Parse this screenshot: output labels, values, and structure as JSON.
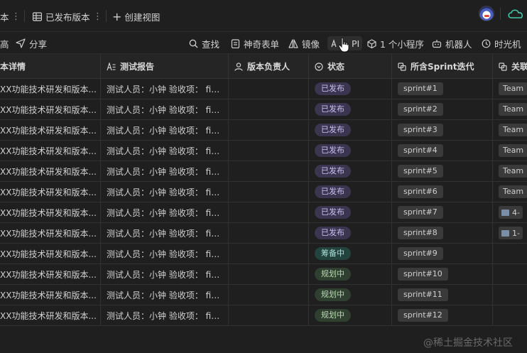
{
  "viewbar": {
    "partial_tab_label": "本",
    "view_tab_label": "已发布版本",
    "create_view_label": "创建视图"
  },
  "toolbar": {
    "partial_label": "高",
    "share_label": "分享",
    "search_label": "查找",
    "magic_form_label": "神奇表单",
    "mirror_label": "镜像",
    "api_label": "PI",
    "mini_program_label": "1 个小程序",
    "robot_label": "机器人",
    "time_machine_label": "时光机"
  },
  "columns": [
    {
      "label": "本详情",
      "icon": "text-icon"
    },
    {
      "label": "测试报告",
      "icon": "long-text-icon"
    },
    {
      "label": "版本负责人",
      "icon": "person-icon"
    },
    {
      "label": "状态",
      "icon": "status-icon"
    },
    {
      "label": "所含Sprint迭代",
      "icon": "link-icon"
    },
    {
      "label": "关联",
      "icon": "link-icon"
    }
  ],
  "rows": [
    {
      "detail": "XX功能技术研发和版本...",
      "report": "测试人员：小钟 验收项： fix...",
      "owner": "",
      "status": "已发布",
      "sprint": "sprint#1",
      "related": "Team",
      "related_type": "team"
    },
    {
      "detail": "XX功能技术研发和版本...",
      "report": "测试人员：小钟 验收项： fix...",
      "owner": "",
      "status": "已发布",
      "sprint": "sprint#2",
      "related": "Team",
      "related_type": "team"
    },
    {
      "detail": "XX功能技术研发和版本...",
      "report": "测试人员：小钟 验收项： fix...",
      "owner": "",
      "status": "已发布",
      "sprint": "sprint#3",
      "related": "Team",
      "related_type": "team"
    },
    {
      "detail": "XX功能技术研发和版本...",
      "report": "测试人员：小钟 验收项： fix...",
      "owner": "",
      "status": "已发布",
      "sprint": "sprint#4",
      "related": "Team",
      "related_type": "team"
    },
    {
      "detail": "XX功能技术研发和版本...",
      "report": "测试人员：小钟 验收项： fix...",
      "owner": "",
      "status": "已发布",
      "sprint": "sprint#5",
      "related": "Team",
      "related_type": "team"
    },
    {
      "detail": "XX功能技术研发和版本...",
      "report": "测试人员：小钟 验收项： fix...",
      "owner": "",
      "status": "已发布",
      "sprint": "sprint#6",
      "related": "Team",
      "related_type": "team"
    },
    {
      "detail": "XX功能技术研发和版本...",
      "report": "测试人员：小钟 验收项： fix...",
      "owner": "",
      "status": "已发布",
      "sprint": "sprint#7",
      "related": "4-",
      "related_type": "iteration"
    },
    {
      "detail": "XX功能技术研发和版本...",
      "report": "测试人员：小钟 验收项： fix...",
      "owner": "",
      "status": "已发布",
      "sprint": "sprint#8",
      "related": "1-",
      "related_type": "iteration"
    },
    {
      "detail": "XX功能技术研发和版本...",
      "report": "测试人员：小钟 验收项： fix...",
      "owner": "",
      "status": "筹备中",
      "sprint": "sprint#9",
      "related": "",
      "related_type": "none"
    },
    {
      "detail": "XX功能技术研发和版本...",
      "report": "测试人员：小钟 验收项： fix...",
      "owner": "",
      "status": "规划中",
      "sprint": "sprint#10",
      "related": "",
      "related_type": "none"
    },
    {
      "detail": "XX功能技术研发和版本...",
      "report": "测试人员：小钟 验收项： fix...",
      "owner": "",
      "status": "规划中",
      "sprint": "sprint#11",
      "related": "",
      "related_type": "none"
    },
    {
      "detail": "XX功能技术研发和版本...",
      "report": "测试人员：小钟 验收项： fix...",
      "owner": "",
      "status": "规划中",
      "sprint": "sprint#12",
      "related": "",
      "related_type": "none"
    }
  ],
  "status_colors": {
    "已发布": {
      "bg": "#3b3550",
      "fg": "#c9bff0"
    },
    "筹备中": {
      "bg": "#23433f",
      "fg": "#a9e0d6"
    },
    "规划中": {
      "bg": "#2f4030",
      "fg": "#b9d9b0"
    }
  },
  "watermark": "@稀土掘金技术社区"
}
